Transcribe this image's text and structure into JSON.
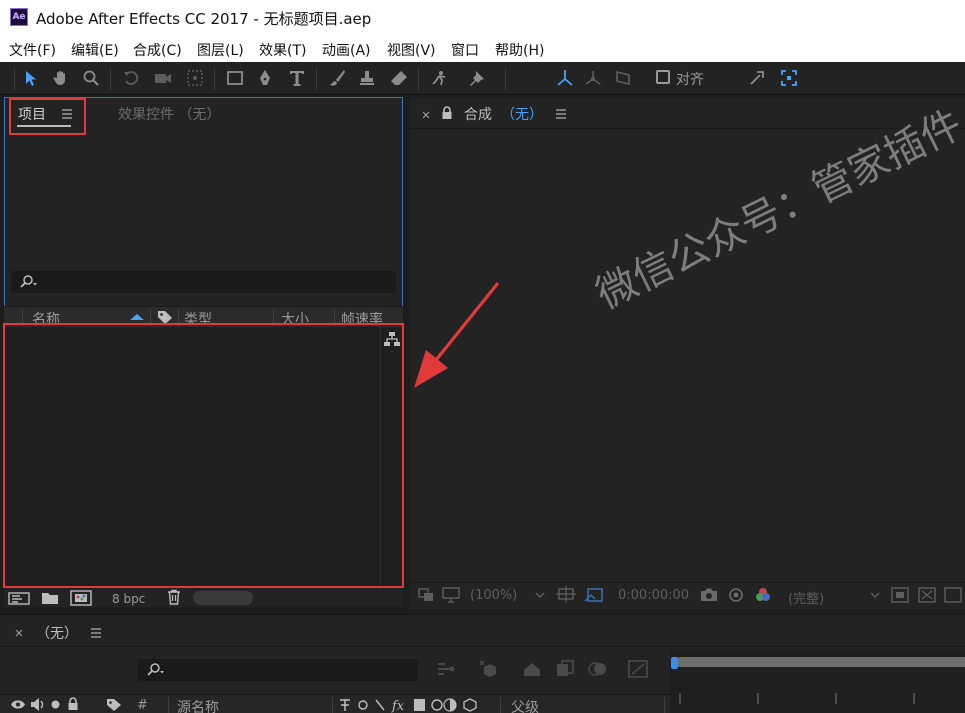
{
  "window": {
    "app_icon_text": "Ae",
    "title": "Adobe After Effects CC 2017 - 无标题项目.aep"
  },
  "menu": [
    "文件(F)",
    "编辑(E)",
    "合成(C)",
    "图层(L)",
    "效果(T)",
    "动画(A)",
    "视图(V)",
    "窗口",
    "帮助(H)"
  ],
  "toolbar": {
    "align_label": "对齐"
  },
  "project_panel": {
    "tab_project": "项目",
    "tab_effects": "效果控件 （无）",
    "columns": [
      "名称",
      "类型",
      "大小",
      "帧速率"
    ],
    "bpc": "8 bpc"
  },
  "comp_panel": {
    "tab_prefix": "合成",
    "tab_value": "（无）",
    "zoom": "(100%)",
    "timecode": "0:00:00:00",
    "quality": "(完整)"
  },
  "timeline": {
    "tab_label": "（无）",
    "columns": [
      "#",
      "源名称",
      "父级"
    ]
  },
  "watermark": "微信公众号：管家插件",
  "colors": {
    "accent_blue": "#4aa3ff",
    "highlight_red": "#e23a3a"
  }
}
